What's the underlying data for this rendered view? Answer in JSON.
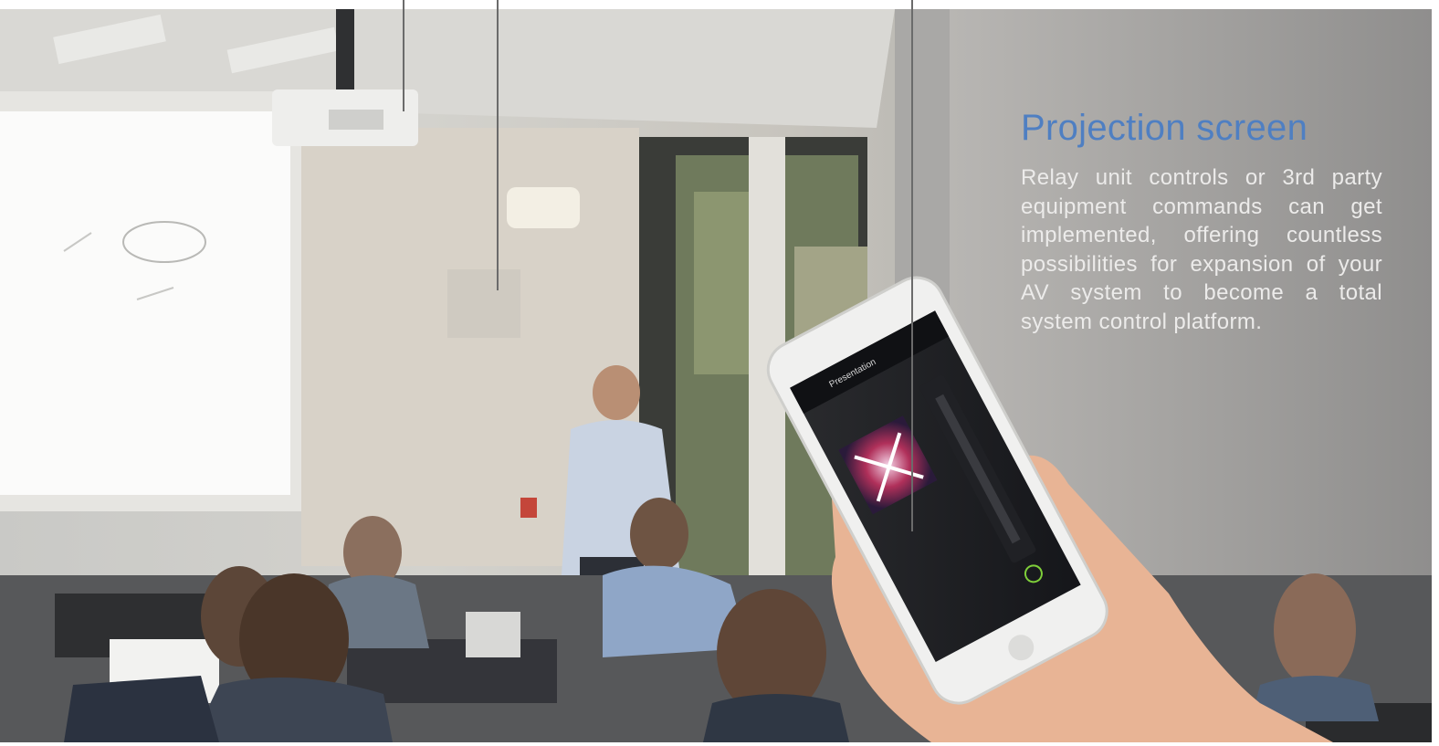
{
  "callout": {
    "title": "Projection screen",
    "description": "Relay unit controls or 3rd party equipment commands can get implemented, offering countless possibilities for expansion of your AV system to become a total system control platform."
  },
  "photo": {
    "subject": "presentation room with audience, projector, presenter and a hand holding a smartphone running a control app",
    "phone_app": {
      "header": "Presentation"
    }
  },
  "colors": {
    "accent_title": "#4f7fc2",
    "body_text": "#ecebea",
    "callout_line": "#6b6b6b"
  }
}
